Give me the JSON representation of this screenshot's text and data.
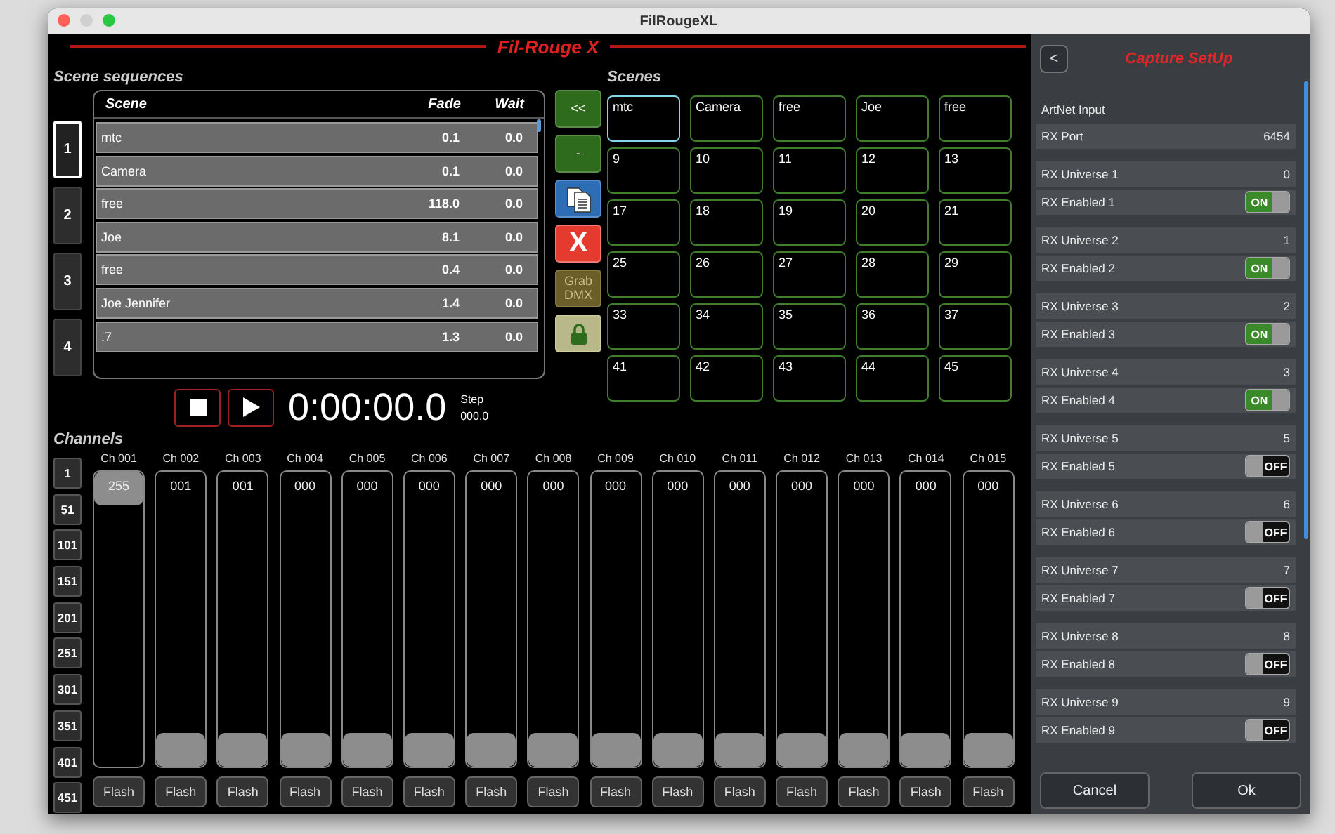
{
  "window": {
    "title": "FilRougeXL"
  },
  "app_title": "Fil-Rouge X",
  "sequences": {
    "title": "Scene sequences",
    "buttons": [
      {
        "label": "1",
        "selected": true
      },
      {
        "label": "2",
        "selected": false
      },
      {
        "label": "3",
        "selected": false
      },
      {
        "label": "4",
        "selected": false
      }
    ],
    "columns": [
      "Scene",
      "Fade",
      "Wait"
    ],
    "rows": [
      {
        "scene": "mtc",
        "fade": "0.1",
        "wait": "0.0"
      },
      {
        "scene": "Camera",
        "fade": "0.1",
        "wait": "0.0"
      },
      {
        "scene": "free",
        "fade": "118.0",
        "wait": "0.0"
      },
      {
        "scene": "Joe",
        "fade": "8.1",
        "wait": "0.0"
      },
      {
        "scene": "free",
        "fade": "0.4",
        "wait": "0.0"
      },
      {
        "scene": "Joe Jennifer",
        "fade": "1.4",
        "wait": "0.0"
      },
      {
        "scene": ".7",
        "fade": "1.3",
        "wait": "0.0"
      }
    ]
  },
  "tools": [
    {
      "kind": "text",
      "label": "<<"
    },
    {
      "kind": "text",
      "label": "-"
    },
    {
      "kind": "copy"
    },
    {
      "kind": "delete",
      "label": "X"
    },
    {
      "kind": "grab",
      "label": "Grab DMX"
    },
    {
      "kind": "lock"
    }
  ],
  "scenes": {
    "title": "Scenes",
    "items": [
      {
        "label": "mtc",
        "selected": true
      },
      {
        "label": "Camera",
        "selected": false
      },
      {
        "label": "free",
        "selected": false
      },
      {
        "label": "Joe",
        "selected": false
      },
      {
        "label": "free",
        "selected": false
      },
      {
        "label": "9",
        "selected": false
      },
      {
        "label": "10",
        "selected": false
      },
      {
        "label": "11",
        "selected": false
      },
      {
        "label": "12",
        "selected": false
      },
      {
        "label": "13",
        "selected": false
      },
      {
        "label": "17",
        "selected": false
      },
      {
        "label": "18",
        "selected": false
      },
      {
        "label": "19",
        "selected": false
      },
      {
        "label": "20",
        "selected": false
      },
      {
        "label": "21",
        "selected": false
      },
      {
        "label": "25",
        "selected": false
      },
      {
        "label": "26",
        "selected": false
      },
      {
        "label": "27",
        "selected": false
      },
      {
        "label": "28",
        "selected": false
      },
      {
        "label": "29",
        "selected": false
      },
      {
        "label": "33",
        "selected": false
      },
      {
        "label": "34",
        "selected": false
      },
      {
        "label": "35",
        "selected": false
      },
      {
        "label": "36",
        "selected": false
      },
      {
        "label": "37",
        "selected": false
      },
      {
        "label": "41",
        "selected": false
      },
      {
        "label": "42",
        "selected": false
      },
      {
        "label": "43",
        "selected": false
      },
      {
        "label": "44",
        "selected": false
      },
      {
        "label": "45",
        "selected": false
      }
    ]
  },
  "transport": {
    "time": "0:00:00.0",
    "step_label": "Step",
    "step": "000.0"
  },
  "channels": {
    "title": "Channels",
    "banks": [
      "1",
      "51",
      "101",
      "151",
      "201",
      "251",
      "301",
      "351",
      "401",
      "451"
    ],
    "faders": [
      {
        "name": "Ch 001",
        "value": "255",
        "level": 1,
        "button": "Flash"
      },
      {
        "name": "Ch 002",
        "value": "001",
        "level": 0,
        "button": "Flash"
      },
      {
        "name": "Ch 003",
        "value": "001",
        "level": 0,
        "button": "Flash"
      },
      {
        "name": "Ch 004",
        "value": "000",
        "level": 0,
        "button": "Flash"
      },
      {
        "name": "Ch 005",
        "value": "000",
        "level": 0,
        "button": "Flash"
      },
      {
        "name": "Ch 006",
        "value": "000",
        "level": 0,
        "button": "Flash"
      },
      {
        "name": "Ch 007",
        "value": "000",
        "level": 0,
        "button": "Flash"
      },
      {
        "name": "Ch 008",
        "value": "000",
        "level": 0,
        "button": "Flash"
      },
      {
        "name": "Ch 009",
        "value": "000",
        "level": 0,
        "button": "Flash"
      },
      {
        "name": "Ch 010",
        "value": "000",
        "level": 0,
        "button": "Flash"
      },
      {
        "name": "Ch 011",
        "value": "000",
        "level": 0,
        "button": "Flash"
      },
      {
        "name": "Ch 012",
        "value": "000",
        "level": 0,
        "button": "Flash"
      },
      {
        "name": "Ch 013",
        "value": "000",
        "level": 0,
        "button": "Flash"
      },
      {
        "name": "Ch 014",
        "value": "000",
        "level": 0,
        "button": "Flash"
      },
      {
        "name": "Ch 015",
        "value": "000",
        "level": 0,
        "button": "Flash"
      }
    ]
  },
  "capture": {
    "back": "<",
    "title": "Capture SetUp",
    "section": "ArtNet Input",
    "port": {
      "label": "RX Port",
      "value": "6454"
    },
    "universes": [
      {
        "label": "RX Universe 1",
        "value": "0",
        "enabled_label": "RX Enabled 1",
        "on": true,
        "toggle": "ON"
      },
      {
        "label": "RX Universe 2",
        "value": "1",
        "enabled_label": "RX Enabled 2",
        "on": true,
        "toggle": "ON"
      },
      {
        "label": "RX Universe 3",
        "value": "2",
        "enabled_label": "RX Enabled 3",
        "on": true,
        "toggle": "ON"
      },
      {
        "label": "RX Universe 4",
        "value": "3",
        "enabled_label": "RX Enabled 4",
        "on": true,
        "toggle": "ON"
      },
      {
        "label": "RX Universe 5",
        "value": "5",
        "enabled_label": "RX Enabled 5",
        "on": false,
        "toggle": "OFF"
      },
      {
        "label": "RX Universe 6",
        "value": "6",
        "enabled_label": "RX Enabled 6",
        "on": false,
        "toggle": "OFF"
      },
      {
        "label": "RX Universe 7",
        "value": "7",
        "enabled_label": "RX Enabled 7",
        "on": false,
        "toggle": "OFF"
      },
      {
        "label": "RX Universe 8",
        "value": "8",
        "enabled_label": "RX Enabled 8",
        "on": false,
        "toggle": "OFF"
      },
      {
        "label": "RX Universe 9",
        "value": "9",
        "enabled_label": "RX Enabled 9",
        "on": false,
        "toggle": "OFF"
      }
    ],
    "buttons": [
      "Cancel",
      "Ok"
    ]
  }
}
